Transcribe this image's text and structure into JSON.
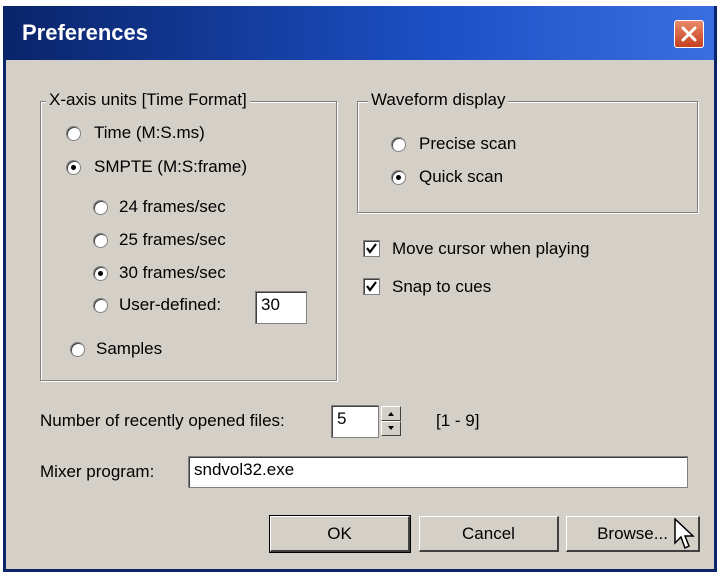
{
  "window": {
    "title": "Preferences"
  },
  "xaxis": {
    "legend": "X-axis units [Time Format]",
    "time_label": "Time (M:S.ms)",
    "smpte_label": "SMPTE (M:S:frame)",
    "fps24_label": "24 frames/sec",
    "fps25_label": "25 frames/sec",
    "fps30_label": "30 frames/sec",
    "user_label": "User-defined:",
    "user_value": "30",
    "samples_label": "Samples",
    "selected_unit": "SMPTE (M:S:frame)",
    "selected_rate": "30 frames/sec"
  },
  "waveform": {
    "legend": "Waveform display",
    "precise_label": "Precise scan",
    "quick_label": "Quick scan",
    "selected": "Quick scan"
  },
  "options": {
    "move_cursor_label": "Move cursor when playing",
    "move_cursor_checked": true,
    "snap_label": "Snap to cues",
    "snap_checked": true
  },
  "recent": {
    "label": "Number of recently opened files:",
    "value": "5",
    "range": "[1 - 9]"
  },
  "mixer": {
    "label": "Mixer program:",
    "value": "sndvol32.exe"
  },
  "buttons": {
    "ok": "OK",
    "cancel": "Cancel",
    "browse": "Browse..."
  },
  "icons": {
    "close": "close-icon",
    "check": "checkmark-icon",
    "cursor": "mouse-pointer-icon"
  },
  "colors": {
    "face": "#d4d0c8",
    "title_start": "#0a246a",
    "title_end": "#3a6ee0",
    "close": "#c6401d"
  }
}
